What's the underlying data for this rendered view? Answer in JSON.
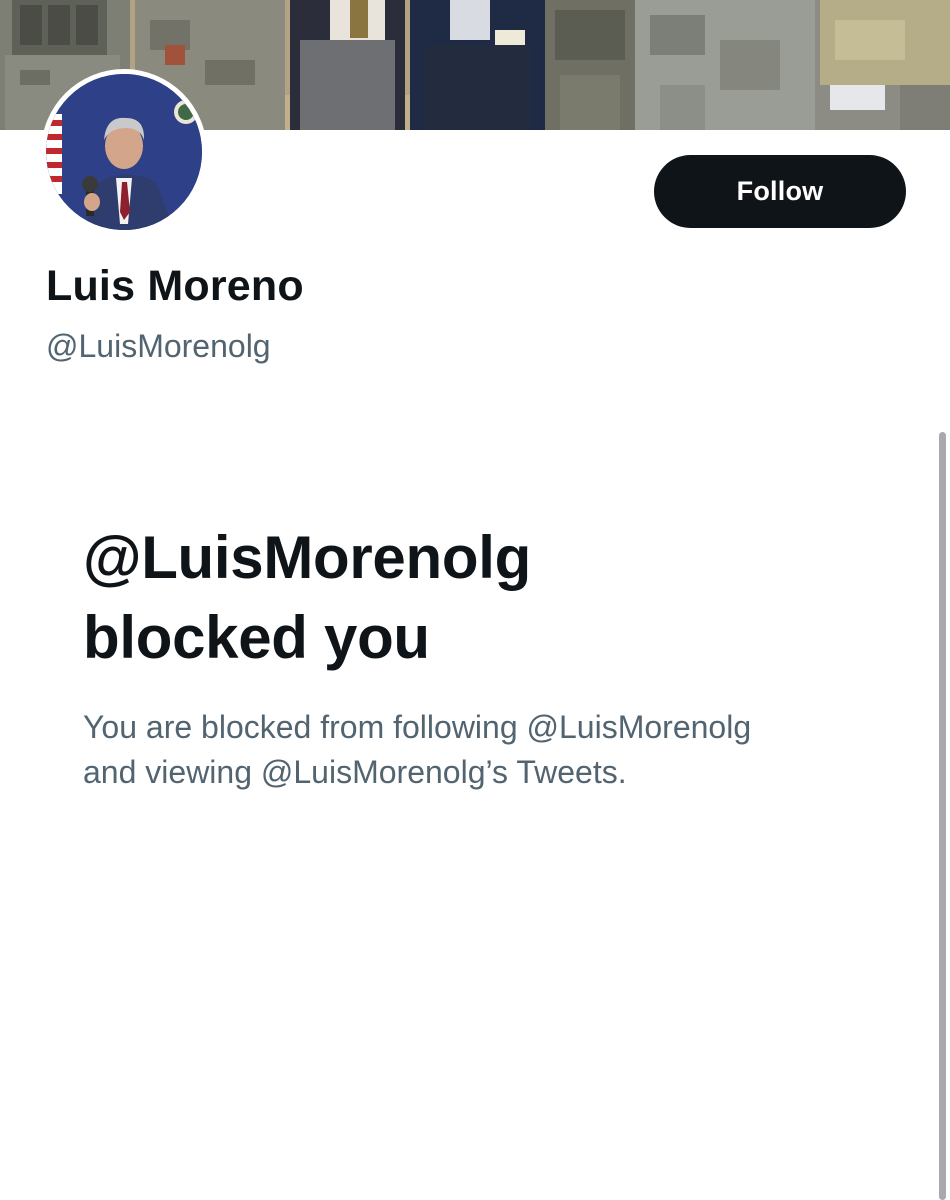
{
  "profile": {
    "display_name": "Luis Moreno",
    "handle": "@LuisMorenolg"
  },
  "actions": {
    "follow_label": "Follow"
  },
  "blocked": {
    "title_line1": "@LuisMorenolg",
    "title_line2": "blocked you",
    "desc_line1": "You are blocked from following @LuisMorenolg",
    "desc_line2": "and viewing @LuisMorenolg’s Tweets."
  },
  "colors": {
    "text_primary": "#0f1419",
    "text_secondary": "#536471",
    "button_bg": "#0f1419",
    "button_text": "#ffffff",
    "background": "#ffffff"
  },
  "icons": {
    "banner": "group-photo-soldiers-banner",
    "avatar": "profile-photo-man-with-microphone"
  }
}
